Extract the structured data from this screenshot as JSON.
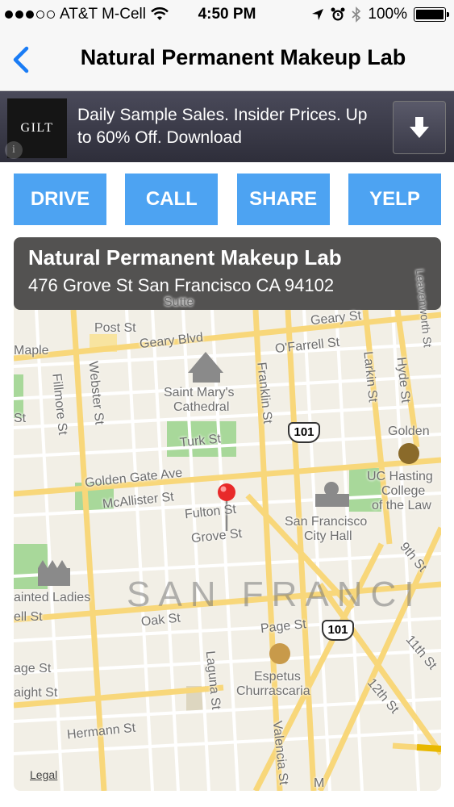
{
  "status_bar": {
    "carrier": "AT&T M-Cell",
    "time": "4:50 PM",
    "battery": "100%",
    "signal_bars_filled": 3,
    "signal_bars_total": 5
  },
  "nav": {
    "title": "Natural Permanent Makeup Lab"
  },
  "ad": {
    "logo": "GILT",
    "text": "Daily Sample Sales. Insider Prices. Up to 60% Off. Download",
    "info_glyph": "i"
  },
  "actions": {
    "drive": "DRIVE",
    "call": "CALL",
    "share": "SHARE",
    "yelp": "YELP"
  },
  "callout": {
    "name": "Natural Permanent Makeup Lab",
    "address": "476 Grove St San Francisco CA 94102"
  },
  "map": {
    "labels": {
      "post_st": "Post St",
      "geary_blvd": "Geary Blvd",
      "geary_st": "Geary St",
      "maple": "Maple",
      "ofarrell_st": "O'Farrell St",
      "larkin_st": "Larkin St",
      "hyde_st": "Hyde St",
      "leavenworth_st": "Leavenworth St",
      "fillmore_st": "Fillmore St",
      "webster_st": "Webster St",
      "st_marys_1": "Saint Mary's",
      "st_marys_2": "Cathedral",
      "franklin_st": "Franklin St",
      "turk_st": "Turk St",
      "golden_gate_ave": "Golden Gate Ave",
      "golden": "Golden",
      "uc_hastings_1": "UC Hasting",
      "uc_hastings_2": "College",
      "uc_hastings_3": "of the Law",
      "mcallister_st": "McAllister St",
      "fulton_st": "Fulton St",
      "grove_st": "Grove St",
      "sf_city_hall_1": "San Francisco",
      "sf_city_hall_2": "City Hall",
      "ninth_st": "9th St",
      "painted_ladies": "ainted Ladies",
      "hell_st": "ell St",
      "oak_st": "Oak St",
      "page_st": "Page St",
      "eleventh_st": "11th St",
      "age_st": "age St",
      "aight_st": "aight St",
      "espetus_1": "Espetus",
      "espetus_2": "Churrascaria",
      "twelfth_st": "12th St",
      "laguna_st": "Laguna St",
      "hermann_st": "Hermann St",
      "valencia_st": "Valencia St",
      "sutter": "Sutte",
      "st_left": "St",
      "san_franci": "SAN FRANCI",
      "m": "M"
    },
    "highway_101_a": "101",
    "highway_101_b": "101",
    "legal": "Legal"
  },
  "colors": {
    "action_blue": "#4da3f2",
    "nav_back": "#1a7cf5",
    "pin_red": "#e82a2a",
    "road_yellow": "#f8d77a",
    "park_green": "#a8d89a",
    "map_bg": "#f2efe6"
  },
  "icons": {
    "back": "chevron-left-icon",
    "download": "download-arrow-icon",
    "wifi": "wifi-icon",
    "location": "location-arrow-icon",
    "alarm": "alarm-clock-icon",
    "bluetooth": "bluetooth-icon",
    "pin": "map-pin-icon"
  }
}
